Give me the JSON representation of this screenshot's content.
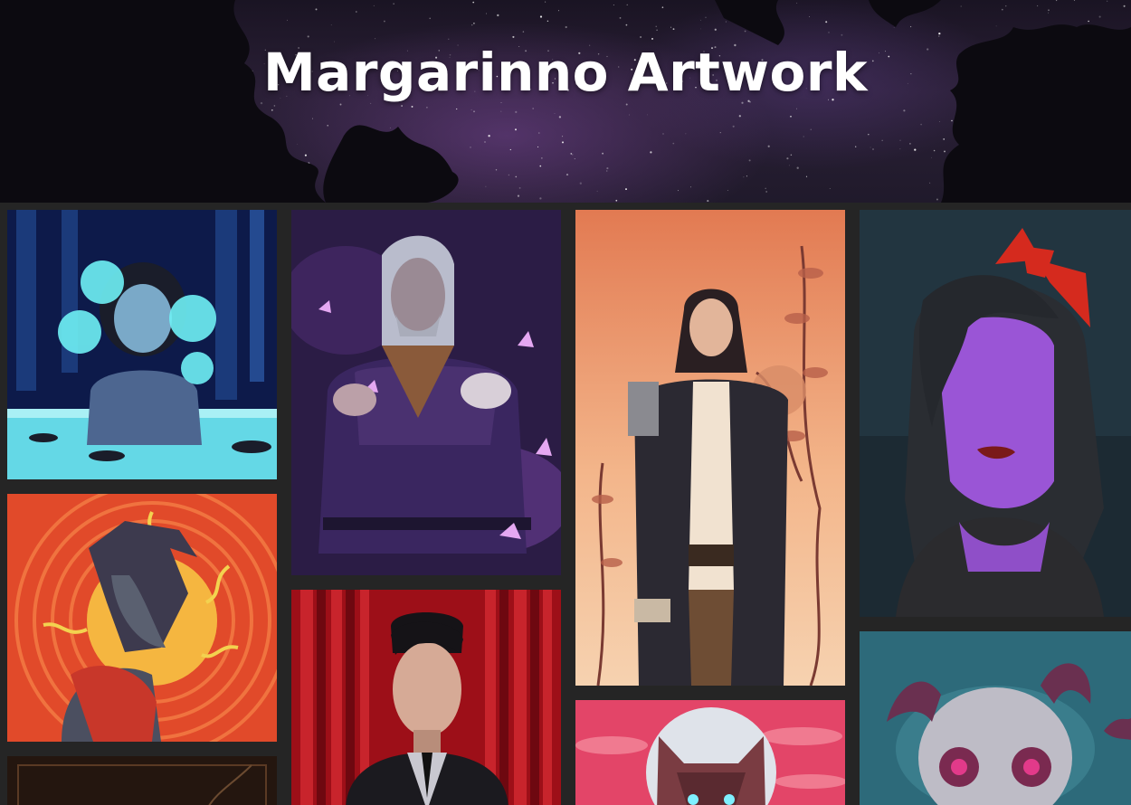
{
  "header": {
    "title": "Margarinno Artwork"
  },
  "gallery": {
    "items": [
      {
        "name": "artwork-glowing-lilies-girl",
        "palette": [
          "#0b1840",
          "#5fe6f0"
        ]
      },
      {
        "name": "artwork-silver-hair-butterflies",
        "palette": [
          "#2a1a44",
          "#c48ee8"
        ]
      },
      {
        "name": "artwork-long-coat-wanderer",
        "palette": [
          "#e58a5a",
          "#2a2630"
        ]
      },
      {
        "name": "artwork-purple-girl-red-bow",
        "palette": [
          "#1e2a33",
          "#9a4fd0"
        ]
      },
      {
        "name": "artwork-elf-sun-orange",
        "palette": [
          "#e4532c",
          "#f3c04a"
        ]
      },
      {
        "name": "artwork-man-red-curtain",
        "palette": [
          "#a3111a",
          "#1d1b20"
        ]
      },
      {
        "name": "artwork-moon-wolf",
        "palette": [
          "#e7456a",
          "#d8dee8"
        ]
      },
      {
        "name": "artwork-horned-skull",
        "palette": [
          "#2f6a7a",
          "#bfbcc4"
        ]
      },
      {
        "name": "artwork-dark-vines",
        "palette": [
          "#2a1a14",
          "#6b4a30"
        ]
      }
    ]
  }
}
